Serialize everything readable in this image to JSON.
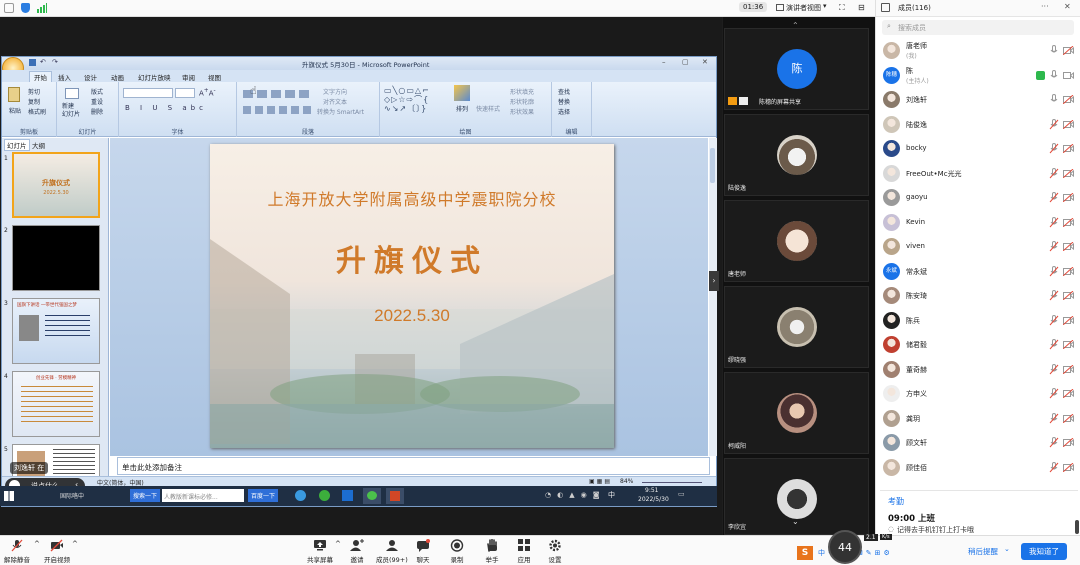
{
  "topbar": {
    "time": "01:36",
    "view_label": "演讲者视图",
    "members_title": "成员(116)"
  },
  "ppt": {
    "title": "升旗仪式 5月30日 - Microsoft PowerPoint",
    "tabs": [
      "开始",
      "插入",
      "设计",
      "动画",
      "幻灯片放映",
      "审阅",
      "视图"
    ],
    "ribbon": {
      "paste": "粘贴",
      "cut": "剪切",
      "copy": "复制",
      "format_painter": "格式刷",
      "new_slide": "新建\n幻灯片",
      "layout": "版式",
      "reset": "重设",
      "delete": "删除",
      "text_direction": "文字方向",
      "align_text": "对齐文本",
      "smartart": "转换为 SmartArt",
      "arrange": "排列",
      "quick_styles": "快速样式",
      "shape_fill": "形状填充",
      "shape_outline": "形状轮廓",
      "shape_effects": "形状效果",
      "find": "查找",
      "replace": "替换",
      "select": "选择",
      "groups": [
        "剪贴板",
        "幻灯片",
        "字体",
        "段落",
        "绘图",
        "编辑"
      ]
    },
    "panel_tabs": [
      "幻灯片",
      "大纲"
    ],
    "thumbs": [
      {
        "num": "1",
        "title": "升旗仪式",
        "date": "2022.5.30"
      },
      {
        "num": "2"
      },
      {
        "num": "3",
        "title": "国旗下讲话 一带世代强国之梦"
      },
      {
        "num": "4",
        "title": "创业先锋 · 劳模精神"
      },
      {
        "num": "5"
      }
    ],
    "slide": {
      "school": "上海开放大学附属高级中学震职院分校",
      "headline": "升旗仪式",
      "date": "2022.5.30"
    },
    "notes": "单击此处添加备注",
    "status": {
      "lang": "中文(简体，中国)",
      "zoom": "84%"
    }
  },
  "speaking": "刘逸轩 在",
  "speaking_bar": "说点什么...",
  "taskbar": {
    "search_btn": "搜索一下",
    "search_placeholder": "人教版新课标必修...",
    "baidu_btn": "百度一下",
    "tray_lang": "中",
    "time": "9:51",
    "date": "2022/5/30",
    "app_label": "国际咯中"
  },
  "videos": [
    {
      "name": "陈穗的屏幕共享",
      "avatar_text": "陈",
      "avatar_color": "#1a73e8"
    },
    {
      "name": "陆俊逸"
    },
    {
      "name": "唐老师"
    },
    {
      "name": "缪晓强"
    },
    {
      "name": "柯威阳"
    },
    {
      "name": "李欣宜"
    }
  ],
  "members": {
    "search_placeholder": "搜索成员",
    "list": [
      {
        "name": "唐老师",
        "sub": "(我)"
      },
      {
        "name": "陈",
        "sub": "(主持人)",
        "avatar_text": "陈穗",
        "avatar_color": "#1a73e8"
      },
      {
        "name": "刘逸轩"
      },
      {
        "name": "陆俊逸"
      },
      {
        "name": "bocky"
      },
      {
        "name": "FreeOut•Mc光光"
      },
      {
        "name": "gaoyu"
      },
      {
        "name": "Kevin"
      },
      {
        "name": "viven"
      },
      {
        "name": "常永斌",
        "avatar_text": "永斌",
        "avatar_color": "#1a73e8"
      },
      {
        "name": "陈安琦"
      },
      {
        "name": "陈兵"
      },
      {
        "name": "储君毅"
      },
      {
        "name": "董奇赫"
      },
      {
        "name": "方申义"
      },
      {
        "name": "龚玥"
      },
      {
        "name": "顾文轩"
      },
      {
        "name": "顾佳佰"
      }
    ],
    "notice": {
      "title": "考勤",
      "time": "09:00  上班",
      "text": "记得去手机钉钉上打卡哦",
      "later": "稍后提醒",
      "ok": "我知道了"
    }
  },
  "net_speed": "44",
  "net_rate": "2.1",
  "net_unit": "K/s",
  "toolbar": [
    {
      "label": "解除静音"
    },
    {
      "label": "开启视频"
    },
    {
      "label": "共享屏幕"
    },
    {
      "label": "邀请"
    },
    {
      "label": "成员(99+)"
    },
    {
      "label": "聊天"
    },
    {
      "label": "录制"
    },
    {
      "label": "举手"
    },
    {
      "label": "应用"
    },
    {
      "label": "设置"
    }
  ],
  "colors": {
    "accent": "#1a73e8",
    "slide_title": "#d07a2a",
    "mic_off": "#e24a3a"
  }
}
